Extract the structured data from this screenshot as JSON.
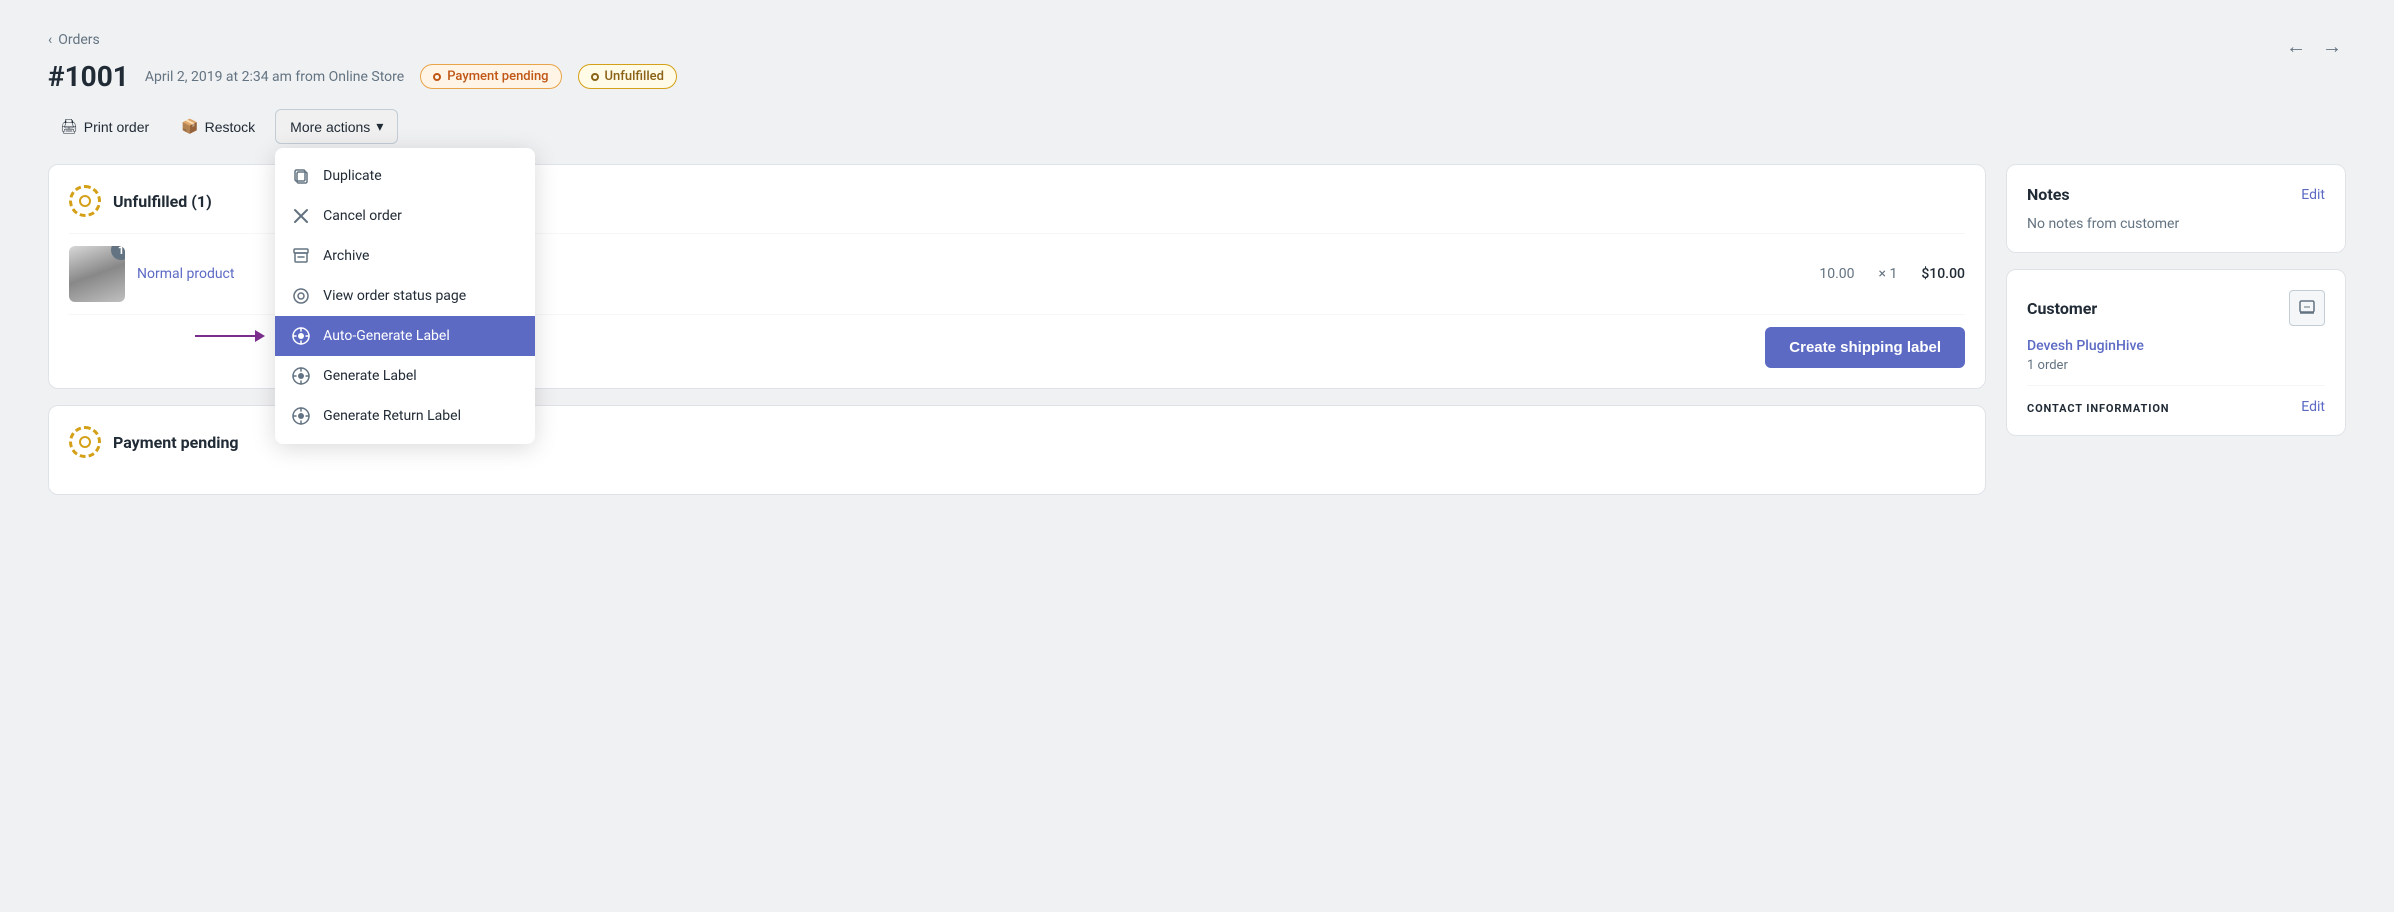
{
  "nav": {
    "back_label": "Orders",
    "prev_arrow": "←",
    "next_arrow": "→"
  },
  "order": {
    "number": "#1001",
    "meta": "April 2, 2019 at 2:34 am from Online Store",
    "badge_payment": "Payment pending",
    "badge_fulfillment": "Unfulfilled"
  },
  "toolbar": {
    "print_label": "Print order",
    "restock_label": "Restock",
    "more_actions_label": "More actions"
  },
  "dropdown": {
    "items": [
      {
        "id": "duplicate",
        "label": "Duplicate",
        "icon": "⧉",
        "highlighted": false
      },
      {
        "id": "cancel",
        "label": "Cancel order",
        "icon": "✕",
        "highlighted": false
      },
      {
        "id": "archive",
        "label": "Archive",
        "icon": "▤",
        "highlighted": false
      },
      {
        "id": "view-status",
        "label": "View order status page",
        "icon": "◉",
        "highlighted": false
      },
      {
        "id": "auto-generate",
        "label": "Auto-Generate Label",
        "icon": "⚙",
        "highlighted": true
      },
      {
        "id": "generate",
        "label": "Generate Label",
        "icon": "⚙",
        "highlighted": false
      },
      {
        "id": "generate-return",
        "label": "Generate Return Label",
        "icon": "⚙",
        "highlighted": false
      }
    ]
  },
  "unfulfilled_section": {
    "title": "Unfulfilled (1)",
    "product": {
      "name": "Normal product",
      "count": "1",
      "price": "10.00",
      "quantity": "× 1",
      "total": "$10.00"
    },
    "create_shipping_label": "Create shipping label"
  },
  "payment_section": {
    "title": "Payment pending"
  },
  "notes_section": {
    "title": "Notes",
    "edit_label": "Edit",
    "content": "No notes from customer"
  },
  "customer_section": {
    "title": "Customer",
    "edit_label": "Edit",
    "customer_name": "Devesh PluginHive",
    "orders_count": "1 order",
    "contact_section_title": "CONTACT INFORMATION"
  }
}
